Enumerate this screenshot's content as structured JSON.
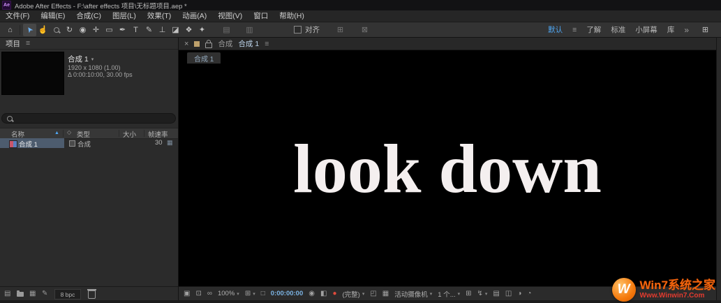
{
  "window": {
    "app_icon": "Ae",
    "title": "Adobe After Effects - F:\\after effects 项目\\无标题项目.aep *"
  },
  "menu_bar": {
    "items": [
      "文件(F)",
      "编辑(E)",
      "合成(C)",
      "图层(L)",
      "效果(T)",
      "动画(A)",
      "视图(V)",
      "窗口",
      "帮助(H)"
    ]
  },
  "toolbar": {
    "tools": [
      {
        "name": "home-tool",
        "glyph": "⌂"
      },
      {
        "name": "selection-tool",
        "glyph": "➤"
      },
      {
        "name": "hand-tool",
        "glyph": "☝"
      },
      {
        "name": "zoom-tool",
        "glyph": ""
      },
      {
        "name": "rotation-tool",
        "glyph": "↻"
      },
      {
        "name": "camera-tool",
        "glyph": "◉"
      },
      {
        "name": "pan-behind-tool",
        "glyph": "✛"
      },
      {
        "name": "shape-tool",
        "glyph": "▭"
      },
      {
        "name": "pen-tool",
        "glyph": "✒"
      },
      {
        "name": "type-tool",
        "glyph": "T"
      },
      {
        "name": "brush-tool",
        "glyph": "✎"
      },
      {
        "name": "clone-stamp-tool",
        "glyph": "⊥"
      },
      {
        "name": "eraser-tool",
        "glyph": "◪"
      },
      {
        "name": "roto-brush-tool",
        "glyph": "❖"
      },
      {
        "name": "puppet-pin-tool",
        "glyph": "✦"
      }
    ],
    "disabled_tools": [
      {
        "name": "fill-swatch",
        "glyph": "▤"
      },
      {
        "name": "stroke-swatch",
        "glyph": "▥"
      }
    ],
    "snap_label": "对齐",
    "post_snap_icons": [
      {
        "name": "snap-options",
        "glyph": "⊞"
      },
      {
        "name": "mask-options",
        "glyph": "⊠"
      }
    ],
    "workspaces": {
      "active": "默认",
      "menu_icon": "≡",
      "items": [
        "了解",
        "标准",
        "小屏幕",
        "库"
      ],
      "overflow": "»",
      "end_icon": "⊞"
    }
  },
  "project_panel": {
    "tab_label": "项目",
    "menu_icon": "≡",
    "preview": {
      "name": "合成 1",
      "caret": "▾",
      "line1": "1920 x 1080 (1.00)",
      "line2": "Δ 0:00:10:00, 30.00 fps"
    },
    "table": {
      "col_name": "名称",
      "sort_arrow": "▲",
      "label_col_icon": "◇",
      "col_type": "类型",
      "col_size": "大小",
      "col_rate": "帧速率",
      "rows": [
        {
          "name": "合成 1",
          "type": "合成",
          "rate": "30",
          "end_icon": "▦"
        }
      ]
    },
    "footer": {
      "bit_depth": "8 bpc",
      "icons": {
        "interpret": "▤",
        "comp": "▦",
        "adjust": "✎"
      }
    }
  },
  "viewer": {
    "tab": {
      "close": "×",
      "panel_label": "合成",
      "comp_name": "合成 1",
      "menu_icon": "≡"
    },
    "mini_tab": "合成 1",
    "canvas_text": "look down",
    "statusbar": {
      "zoom": "100%",
      "timecode": "0:00:00:00",
      "resolution": "(完整)",
      "camera": "活动摄像机",
      "layout": "1 个...",
      "caret": "▾",
      "icons": {
        "always_preview": "▣",
        "main_viewer": "⊡",
        "vr": "∞",
        "grid": "⊞",
        "mask": "□",
        "snapshot": "◉",
        "show_snapshot": "◧",
        "channels": "●",
        "roi": "◰",
        "transparency": "▦",
        "pixel_aspect": "⊞",
        "fast_preview": "↯",
        "timeline": "▤",
        "flowchart": "◫",
        "exposure_reset": "◑",
        "exposure": "◔"
      }
    }
  },
  "watermark": {
    "badge": "W",
    "title": "Win7系统之家",
    "url": "Www.Winwin7.Com"
  }
}
